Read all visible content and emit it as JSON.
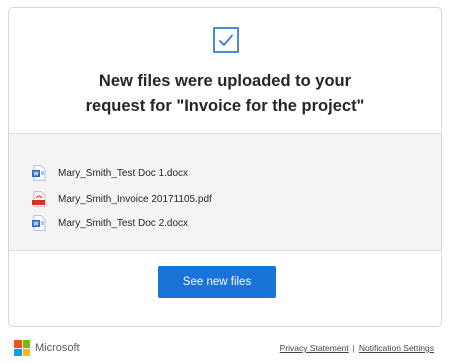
{
  "header": {
    "title_line1": "New files were uploaded to your",
    "title_line2": "request for \"Invoice for the project\""
  },
  "files": [
    {
      "name": "Mary_Smith_Test Doc 1.docx",
      "icon": "word-doc-icon"
    },
    {
      "name": "Mary_Smith_Invoice 20171105.pdf",
      "icon": "pdf-doc-icon"
    },
    {
      "name": "Mary_Smith_Test Doc 2.docx",
      "icon": "word-doc-icon"
    }
  ],
  "action": {
    "label": "See new files"
  },
  "footer": {
    "brand": "Microsoft",
    "links": [
      "Privacy Statement",
      "Notification Settings"
    ],
    "separator": "|"
  },
  "colors": {
    "accent": "#1a73d8",
    "word": "#2b6cc4",
    "pdf": "#d93025",
    "ms_red": "#f25022",
    "ms_green": "#7fba00",
    "ms_blue": "#00a4ef",
    "ms_yellow": "#ffb900"
  }
}
